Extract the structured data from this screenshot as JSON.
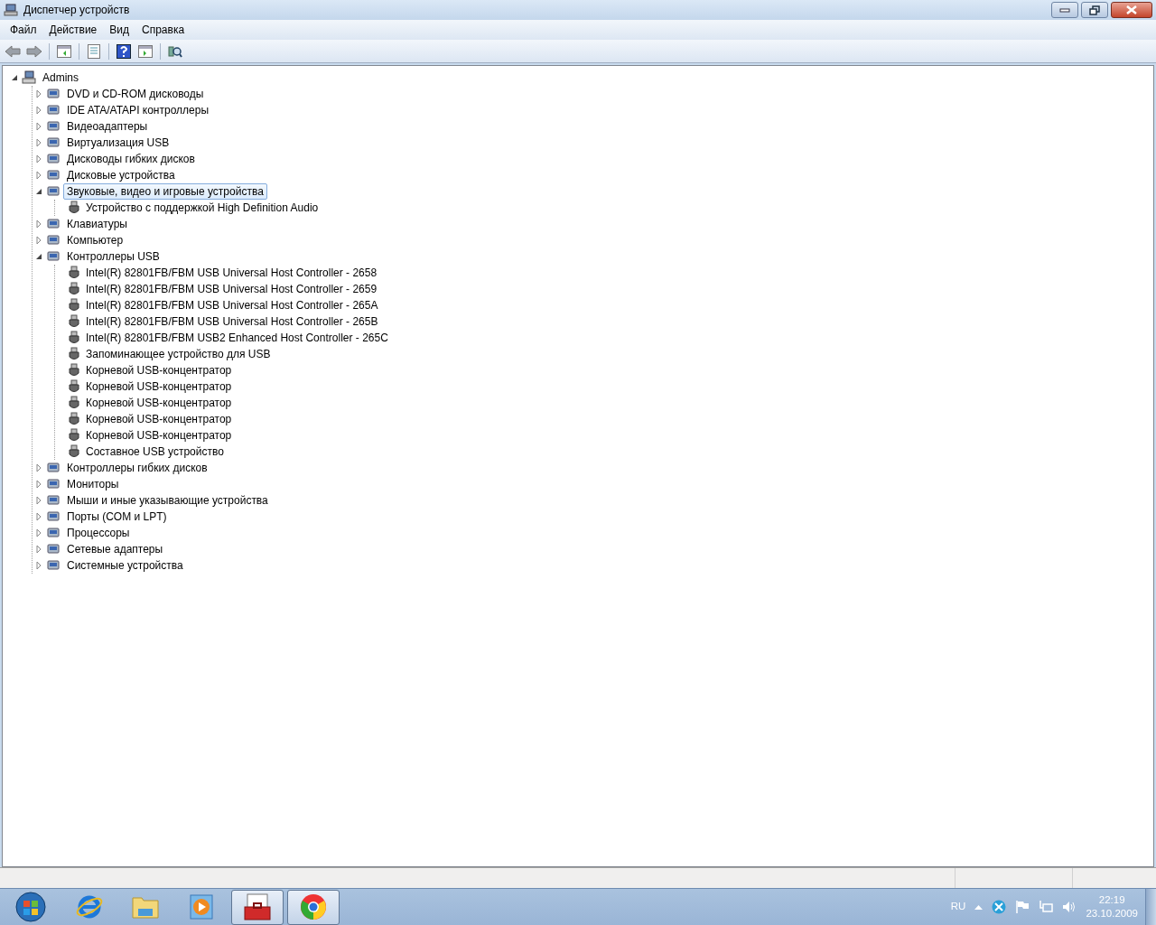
{
  "window": {
    "title": "Диспетчер устройств"
  },
  "menu": [
    "Файл",
    "Действие",
    "Вид",
    "Справка"
  ],
  "tree": [
    {
      "label": "Admins",
      "expanded": true,
      "selected": false,
      "children": [
        {
          "label": "DVD и CD-ROM дисководы",
          "expanded": false,
          "selected": false
        },
        {
          "label": "IDE ATA/ATAPI контроллеры",
          "expanded": false,
          "selected": false
        },
        {
          "label": "Видеоадаптеры",
          "expanded": false,
          "selected": false
        },
        {
          "label": "Виртуализация USB",
          "expanded": false,
          "selected": false
        },
        {
          "label": "Дисководы гибких дисков",
          "expanded": false,
          "selected": false
        },
        {
          "label": "Дисковые устройства",
          "expanded": false,
          "selected": false
        },
        {
          "label": "Звуковые, видео и игровые устройства",
          "expanded": true,
          "selected": true,
          "children": [
            {
              "label": "Устройство с поддержкой High Definition Audio",
              "selected": false
            }
          ]
        },
        {
          "label": "Клавиатуры",
          "expanded": false,
          "selected": false
        },
        {
          "label": "Компьютер",
          "expanded": false,
          "selected": false
        },
        {
          "label": "Контроллеры USB",
          "expanded": true,
          "selected": false,
          "children": [
            {
              "label": "Intel(R) 82801FB/FBM USB Universal Host Controller - 2658",
              "selected": false
            },
            {
              "label": "Intel(R) 82801FB/FBM USB Universal Host Controller - 2659",
              "selected": false
            },
            {
              "label": "Intel(R) 82801FB/FBM USB Universal Host Controller - 265A",
              "selected": false
            },
            {
              "label": "Intel(R) 82801FB/FBM USB Universal Host Controller - 265B",
              "selected": false
            },
            {
              "label": "Intel(R) 82801FB/FBM USB2 Enhanced Host Controller - 265C",
              "selected": false
            },
            {
              "label": "Запоминающее устройство для USB",
              "selected": false
            },
            {
              "label": "Корневой USB-концентратор",
              "selected": false
            },
            {
              "label": "Корневой USB-концентратор",
              "selected": false
            },
            {
              "label": "Корневой USB-концентратор",
              "selected": false
            },
            {
              "label": "Корневой USB-концентратор",
              "selected": false
            },
            {
              "label": "Корневой USB-концентратор",
              "selected": false
            },
            {
              "label": "Составное USB устройство",
              "selected": false
            }
          ]
        },
        {
          "label": "Контроллеры гибких дисков",
          "expanded": false,
          "selected": false
        },
        {
          "label": "Мониторы",
          "expanded": false,
          "selected": false
        },
        {
          "label": "Мыши и иные указывающие устройства",
          "expanded": false,
          "selected": false
        },
        {
          "label": "Порты (COM и LPT)",
          "expanded": false,
          "selected": false
        },
        {
          "label": "Процессоры",
          "expanded": false,
          "selected": false
        },
        {
          "label": "Сетевые адаптеры",
          "expanded": false,
          "selected": false
        },
        {
          "label": "Системные устройства",
          "expanded": false,
          "selected": false
        }
      ]
    }
  ],
  "taskbar": {
    "apps": [
      {
        "kind": "browser",
        "open": false
      },
      {
        "kind": "folder",
        "open": false
      },
      {
        "kind": "media",
        "open": false
      },
      {
        "kind": "toolbox",
        "open": true
      },
      {
        "kind": "chrome",
        "open": true
      }
    ],
    "language": "RU",
    "time": "22:19",
    "date": "23.10.2009"
  }
}
